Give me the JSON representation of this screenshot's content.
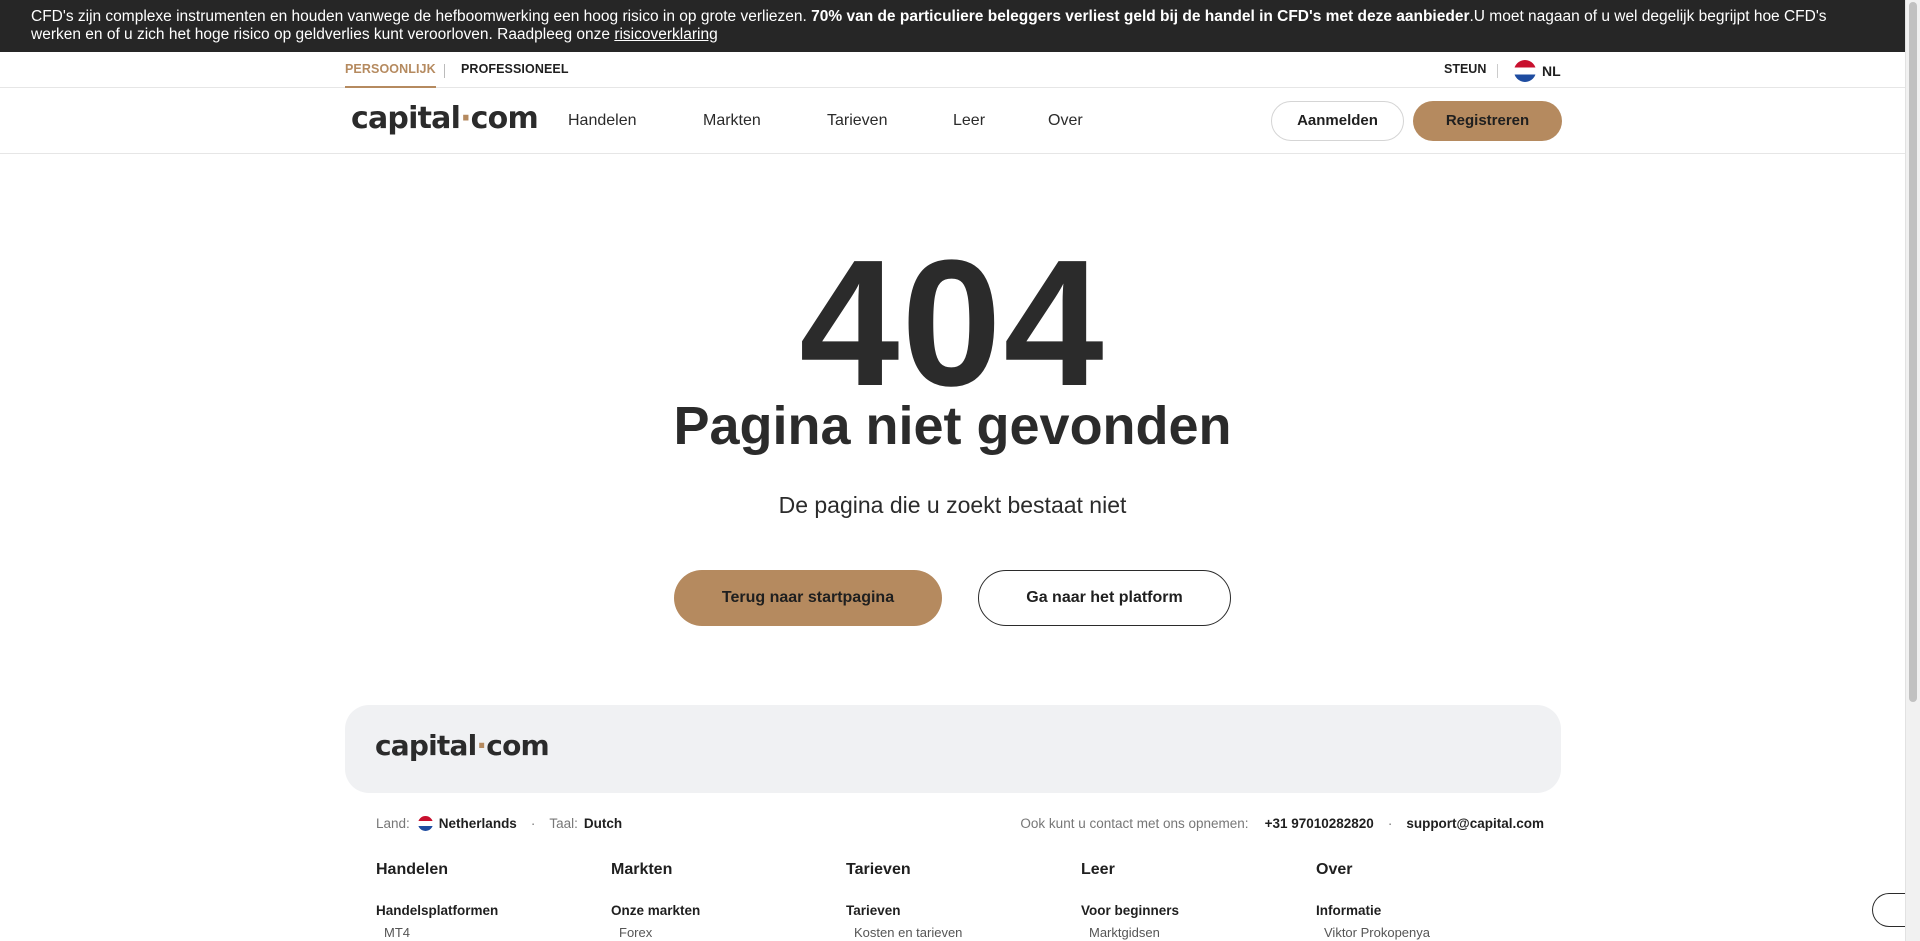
{
  "risk_banner": {
    "text_prefix": "CFD's zijn complexe instrumenten en houden vanwege de hefboomwerking een hoog risico in op grote verliezen. ",
    "text_bold": "70% van de particuliere beleggers verliest geld bij de handel in CFD's met deze aanbieder",
    "text_suffix": ".U moet nagaan of u wel degelijk begrijpt hoe CFD's werken en of u zich het hoge risico op geldverlies kunt veroorloven. Raadpleeg onze ",
    "link": "risicoverklaring"
  },
  "segment_bar": {
    "tabs": [
      {
        "label": "PERSOONLIJK",
        "active": true
      },
      {
        "label": "PROFESSIONEEL",
        "active": false
      }
    ],
    "support_label": "STEUN",
    "language": "NL"
  },
  "header": {
    "logo_left": "capital",
    "logo_dot": "·",
    "logo_right": "com",
    "nav": [
      "Handelen",
      "Markten",
      "Tarieven",
      "Leer",
      "Over"
    ],
    "login_label": "Aanmelden",
    "register_label": "Registreren"
  },
  "error": {
    "code": "404",
    "title": "Pagina niet gevonden",
    "subtitle": "De pagina die u zoekt bestaat niet",
    "home_button": "Terug naar startpagina",
    "platform_button": "Ga naar het platform"
  },
  "footer": {
    "country_label": "Land:",
    "country_value": "Netherlands",
    "language_label": "Taal:",
    "language_value": "Dutch",
    "contact_label": "Ook kunt u contact met ons opnemen:",
    "phone": "+31 97010282820",
    "email": "support@capital.com",
    "columns": [
      {
        "heading": "Handelen",
        "subheading": "Handelsplatformen",
        "first_link": "MT4"
      },
      {
        "heading": "Markten",
        "subheading": "Onze markten",
        "first_link": "Forex"
      },
      {
        "heading": "Tarieven",
        "subheading": "Tarieven",
        "first_link": "Kosten en tarieven"
      },
      {
        "heading": "Leer",
        "subheading": "Voor beginners",
        "first_link": "Marktgidsen"
      },
      {
        "heading": "Over",
        "subheading": "Informatie",
        "first_link": "Viktor Prokopenya"
      }
    ]
  },
  "colors": {
    "accent": "#b58a5f",
    "banner_bg": "#262626",
    "text": "#2b2b2b"
  }
}
